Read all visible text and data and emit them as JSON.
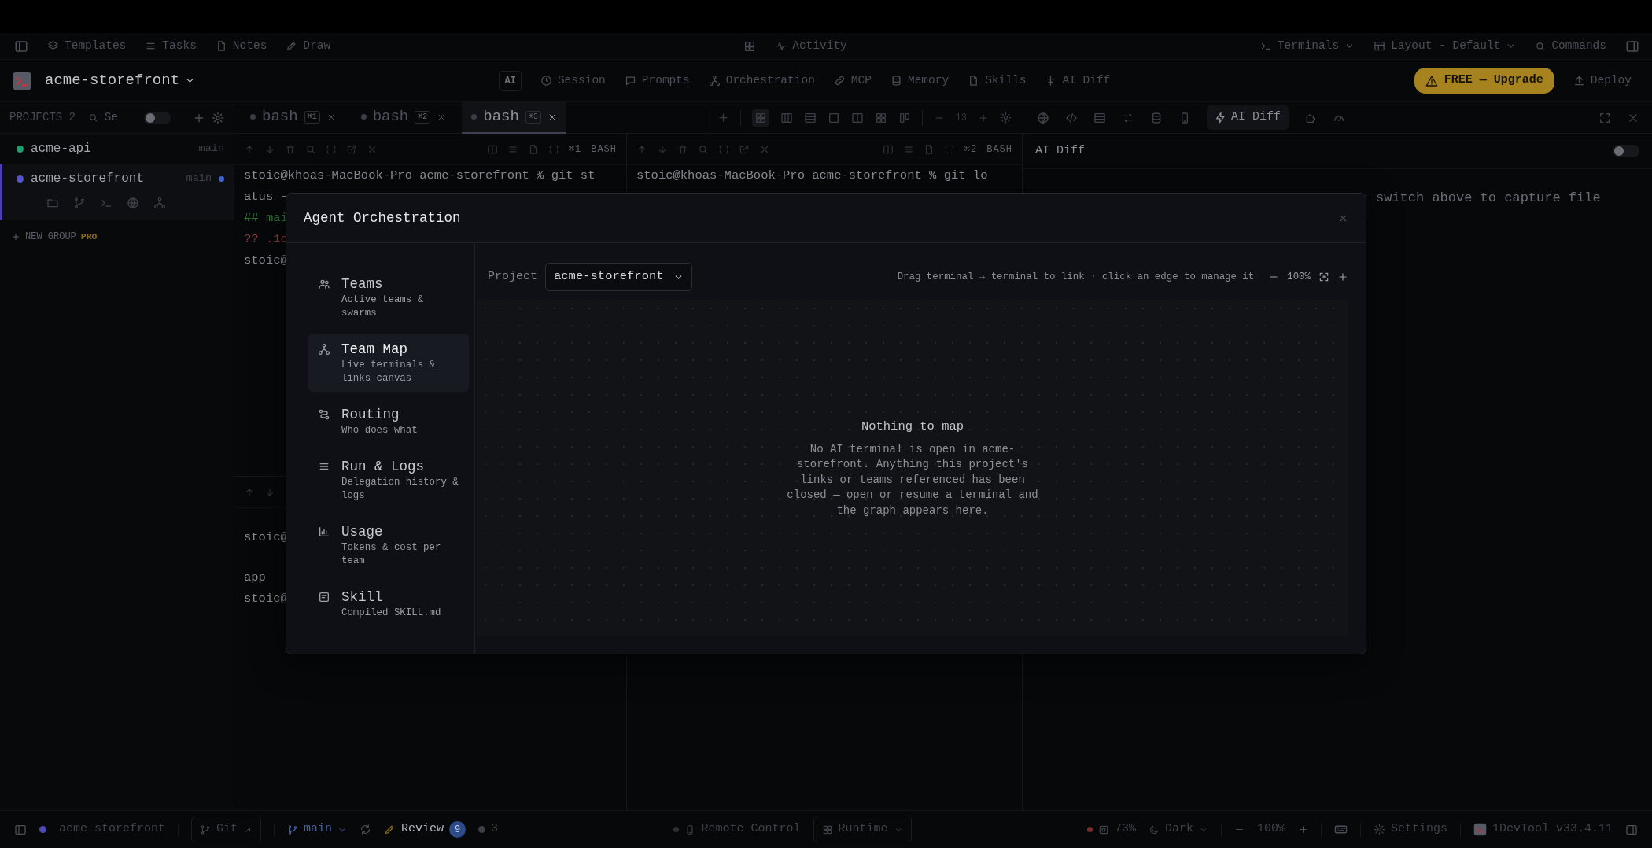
{
  "toolbar": {
    "items": [
      {
        "label": "Templates"
      },
      {
        "label": "Tasks"
      },
      {
        "label": "Notes"
      },
      {
        "label": "Draw"
      }
    ],
    "activity": "Activity",
    "terminals": "Terminals",
    "layout": "Layout - Default",
    "commands": "Commands"
  },
  "project_bar": {
    "project": "acme-storefront",
    "ai_badge": "AI",
    "nav": [
      {
        "label": "Session"
      },
      {
        "label": "Prompts"
      },
      {
        "label": "Orchestration"
      },
      {
        "label": "MCP"
      },
      {
        "label": "Memory"
      },
      {
        "label": "Skills"
      },
      {
        "label": "AI Diff"
      }
    ],
    "upgrade": "FREE — Upgrade",
    "deploy": "Deploy"
  },
  "sidebar": {
    "title": "PROJECTS 2",
    "search": {
      "value": "Se"
    },
    "toggle_on": false,
    "projects": [
      {
        "name": "acme-api",
        "branch": "main",
        "color": "#1f9d6b",
        "selected": false,
        "dirty": false
      },
      {
        "name": "acme-storefront",
        "branch": "main",
        "color": "#5753c9",
        "selected": true,
        "dirty": true
      }
    ],
    "new_group": "NEW GROUP",
    "new_group_badge": "PRO"
  },
  "terminal_tabs": [
    {
      "label": "bash",
      "shortcut": "⌘1",
      "selected": false
    },
    {
      "label": "bash",
      "shortcut": "⌘2",
      "selected": false
    },
    {
      "label": "bash",
      "shortcut": "⌘3",
      "selected": true
    }
  ],
  "font_size": "13",
  "panes": [
    {
      "shortcut": "⌘1",
      "shell": "BASH",
      "lines": [
        {
          "text": "stoic@khoas-MacBook-Pro acme-storefront % git st",
          "kind": "output"
        },
        {
          "text": "atus -",
          "kind": "output"
        },
        {
          "text": "## mai",
          "kind": "branch"
        },
        {
          "text": "?? .1c",
          "kind": "untracked"
        },
        {
          "text": "stoic@",
          "kind": "output"
        }
      ]
    },
    {
      "shortcut": "⌘2",
      "shell": "BASH",
      "lines": [
        {
          "text": "stoic@khoas-MacBook-Pro acme-storefront % git lo",
          "kind": "output"
        }
      ]
    }
  ],
  "lower_pane": {
    "blocks": [
      {
        "lines": [
          "stoic@"
        ]
      },
      {
        "lines": [
          "app",
          "stoic@"
        ]
      }
    ]
  },
  "right_panel": {
    "active_tool": "AI Diff",
    "title": "AI Diff",
    "toggle_on": false,
    "message": "switch above to capture file"
  },
  "modal": {
    "title": "Agent Orchestration",
    "nav": [
      {
        "title": "Teams",
        "subtitle": "Active teams & swarms",
        "selected": false
      },
      {
        "title": "Team Map",
        "subtitle": "Live terminals & links canvas",
        "selected": true
      },
      {
        "title": "Routing",
        "subtitle": "Who does what",
        "selected": false
      },
      {
        "title": "Run & Logs",
        "subtitle": "Delegation history & logs",
        "selected": false
      },
      {
        "title": "Usage",
        "subtitle": "Tokens & cost per team",
        "selected": false
      },
      {
        "title": "Skill",
        "subtitle": "Compiled SKILL.md",
        "selected": false
      }
    ],
    "project_label": "Project",
    "project_value": "acme-storefront",
    "hint": "Drag terminal → terminal to link · click an edge to manage it",
    "zoom": "100%",
    "empty_title": "Nothing to map",
    "empty_text": "No AI terminal is open in acme-storefront. Anything this project's links or teams referenced has been closed — open or resume a terminal and the graph appears here."
  },
  "status_bar": {
    "project": "acme-storefront",
    "git": "Git",
    "branch": "main",
    "review": "Review",
    "review_count": "9",
    "count": "3",
    "remote": "Remote Control",
    "runtime": "Runtime",
    "memory": "73%",
    "theme": "Dark",
    "zoom": "100%",
    "settings": "Settings",
    "version": "1DevTool v33.4.11"
  }
}
